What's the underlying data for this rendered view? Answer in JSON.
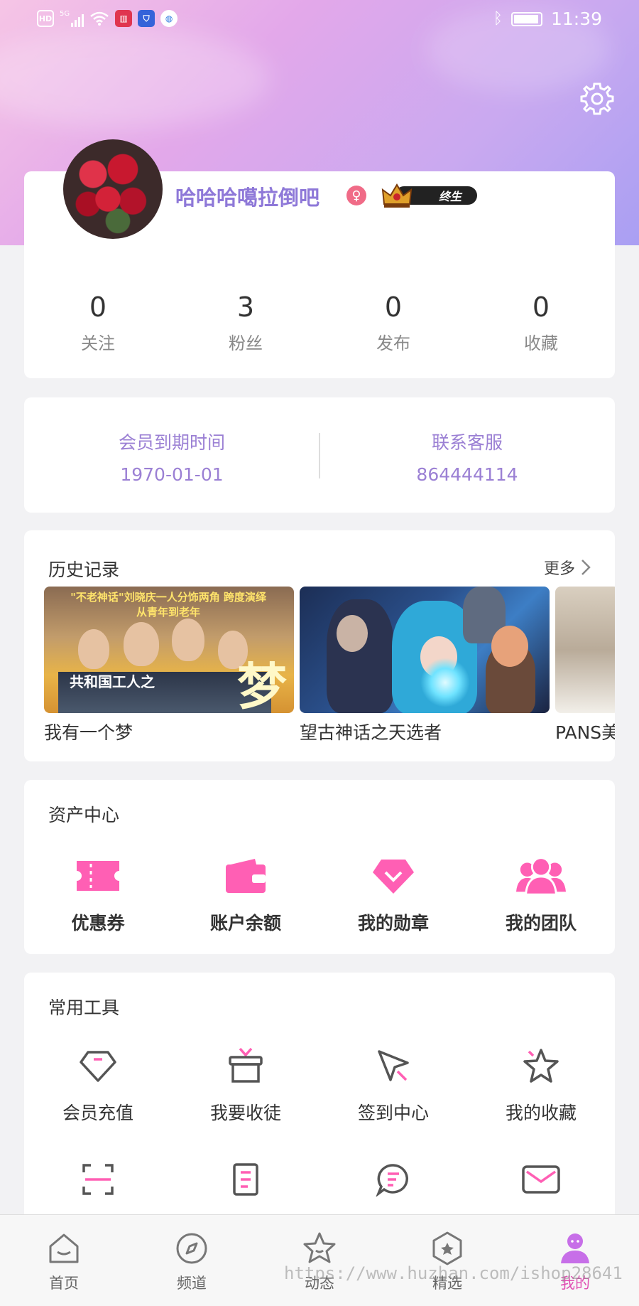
{
  "status_bar": {
    "time": "11:39",
    "left_icons": [
      "hd-icon",
      "signal-5g-icon",
      "wifi-icon",
      "reader-icon",
      "shield-icon",
      "browser-icon"
    ],
    "hd": "HD",
    "net": "5G"
  },
  "profile": {
    "username": "哈哈哈噶拉倒吧",
    "gender_symbol": "♀",
    "level_badge": "终生",
    "stats": [
      {
        "value": "0",
        "label": "关注"
      },
      {
        "value": "3",
        "label": "粉丝"
      },
      {
        "value": "0",
        "label": "发布"
      },
      {
        "value": "0",
        "label": "收藏"
      }
    ]
  },
  "membership": {
    "expiry_label": "会员到期时间",
    "expiry_value": "1970-01-01",
    "service_label": "联系客服",
    "service_value": "864444114"
  },
  "history": {
    "title": "历史记录",
    "more": "更多",
    "items": [
      {
        "title": "我有一个梦",
        "banner": "\"不老神话\"刘晓庆一人分饰两角 跨度演绎从青年到老年",
        "poster_text": "共和国工人之",
        "poster_big": "梦"
      },
      {
        "title": "望古神话之天选者"
      },
      {
        "title": "PANS美"
      }
    ]
  },
  "assets": {
    "title": "资产中心",
    "items": [
      {
        "label": "优惠券",
        "icon": "coupon-icon"
      },
      {
        "label": "账户余额",
        "icon": "wallet-icon"
      },
      {
        "label": "我的勋章",
        "icon": "medal-icon"
      },
      {
        "label": "我的团队",
        "icon": "team-icon"
      }
    ]
  },
  "tools": {
    "title": "常用工具",
    "items": [
      {
        "label": "会员充值",
        "icon": "diamond-icon"
      },
      {
        "label": "我要收徒",
        "icon": "gift-box-icon"
      },
      {
        "label": "签到中心",
        "icon": "cursor-icon"
      },
      {
        "label": "我的收藏",
        "icon": "star-icon"
      }
    ],
    "row2_icons": [
      "scan-icon",
      "document-icon",
      "chat-icon",
      "mail-icon"
    ]
  },
  "tabbar": {
    "items": [
      {
        "label": "首页",
        "icon": "home-icon"
      },
      {
        "label": "频道",
        "icon": "compass-icon"
      },
      {
        "label": "动态",
        "icon": "star-face-icon"
      },
      {
        "label": "精选",
        "icon": "hexagon-icon"
      },
      {
        "label": "我的",
        "icon": "profile-icon",
        "active": true
      }
    ]
  },
  "watermark": "https://www.huzhan.com/ishop28641",
  "colors": {
    "accent_purple": "#8e78d8",
    "accent_pink": "#f05fb8",
    "icon_pink": "#ff5fb4"
  }
}
